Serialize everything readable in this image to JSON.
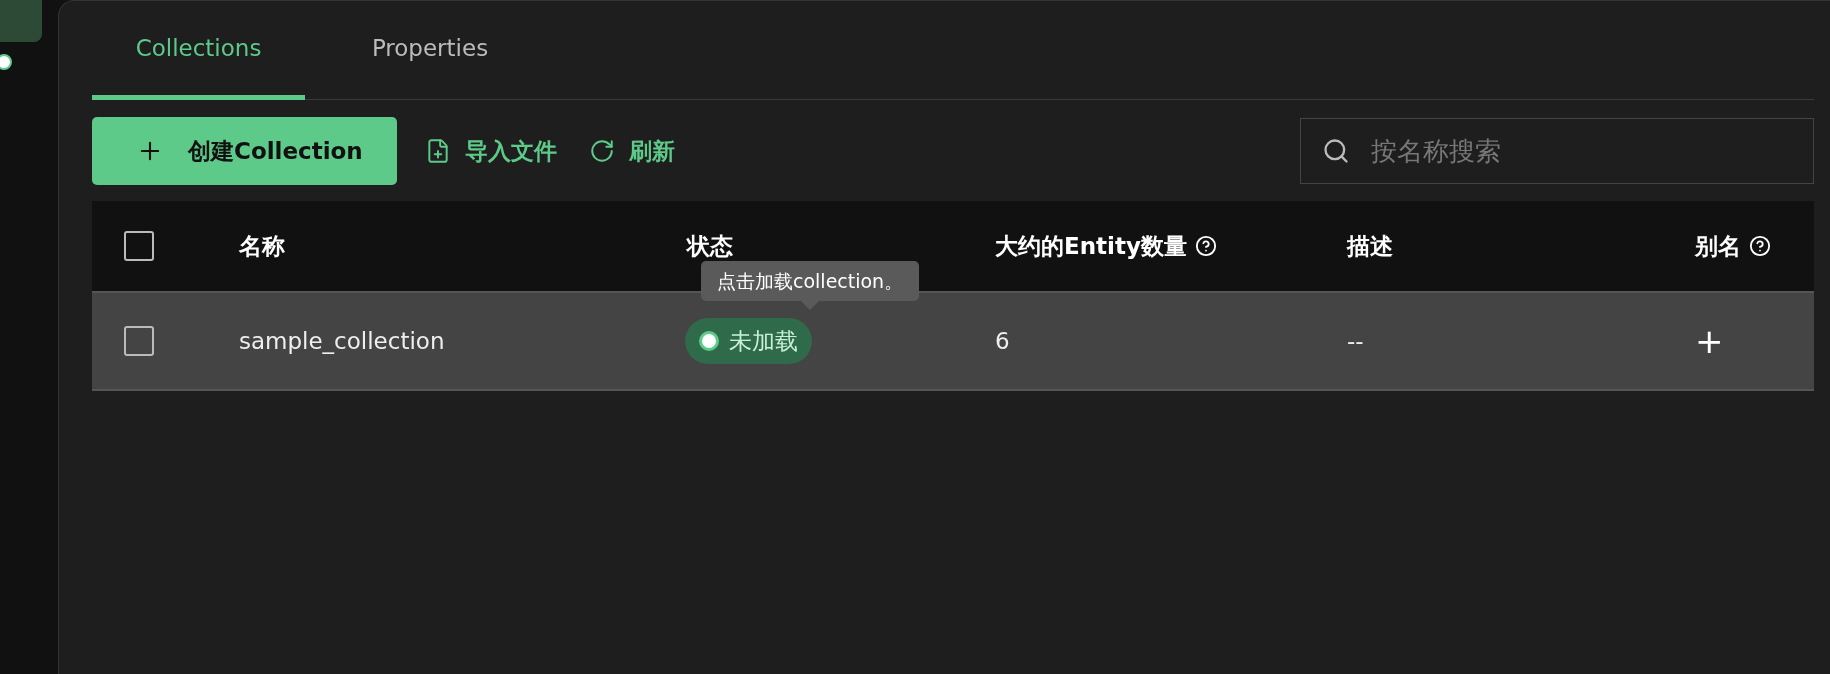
{
  "sidebar": {
    "items": [
      {
        "kind": "block",
        "selected": true
      },
      {
        "kind": "dot",
        "selected": false
      }
    ]
  },
  "tabs": [
    {
      "label": "Collections",
      "selected": true
    },
    {
      "label": "Properties",
      "selected": false
    }
  ],
  "toolbar": {
    "buttons": [
      {
        "kind": "primary",
        "label": "创建Collection"
      },
      {
        "kind": "link",
        "label": "导入文件"
      },
      {
        "kind": "link",
        "label": "刷新"
      }
    ],
    "search": {
      "placeholder": "按名称搜索"
    }
  },
  "table": {
    "header_checked": false,
    "columns": [
      {
        "label": "名称",
        "help": false
      },
      {
        "label": "状态",
        "help": false
      },
      {
        "label": "大约的Entity数量",
        "help": true
      },
      {
        "label": "描述",
        "help": false
      },
      {
        "label": "别名",
        "help": true
      }
    ],
    "rows": [
      {
        "checked": false,
        "hovered": true,
        "name": "sample_collection",
        "status": "未加载",
        "entities": "6",
        "description": "--",
        "alias_action": "+"
      }
    ]
  },
  "tooltip": {
    "text": "点击加载collection。"
  }
}
